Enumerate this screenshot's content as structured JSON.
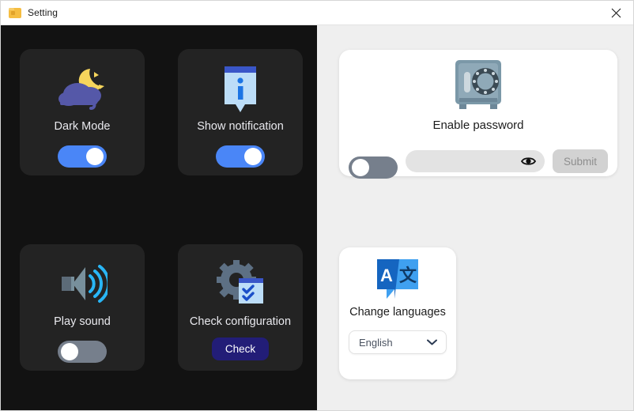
{
  "window": {
    "title": "Setting",
    "app_icon": "folder-icon",
    "close_label": "✕"
  },
  "dark_panel": {
    "cards": [
      {
        "id": "dark-mode",
        "icon": "moon-cloud-icon",
        "label": "Dark Mode",
        "control": "toggle",
        "state": "on"
      },
      {
        "id": "show-notification",
        "icon": "info-notification-icon",
        "label": "Show notification",
        "control": "toggle",
        "state": "on"
      },
      {
        "id": "play-sound",
        "icon": "speaker-icon",
        "label": "Play sound",
        "control": "toggle",
        "state": "off"
      },
      {
        "id": "check-configuration",
        "icon": "gear-checklist-icon",
        "label": "Check configuration",
        "control": "button",
        "button_label": "Check"
      }
    ]
  },
  "light_panel": {
    "password_card": {
      "icon": "safe-vault-icon",
      "label": "Enable password",
      "toggle_state": "off",
      "input_value": "",
      "input_placeholder": "",
      "eye_icon": "eye-icon",
      "submit_label": "Submit",
      "submit_disabled": true
    },
    "language_card": {
      "icon": "translate-icon",
      "label": "Change languages",
      "selected_language": "English",
      "options": [
        "English"
      ],
      "chevron_icon": "chevron-down-icon"
    }
  },
  "colors": {
    "dark_panel_bg": "#121212",
    "dark_card_bg": "#232323",
    "light_panel_bg": "#efefef",
    "toggle_on": "#4a86f7",
    "toggle_off": "#767f8c",
    "check_button": "#221d77",
    "submit_disabled": "#d2d2d2",
    "app_icon": "#f5bd41"
  }
}
